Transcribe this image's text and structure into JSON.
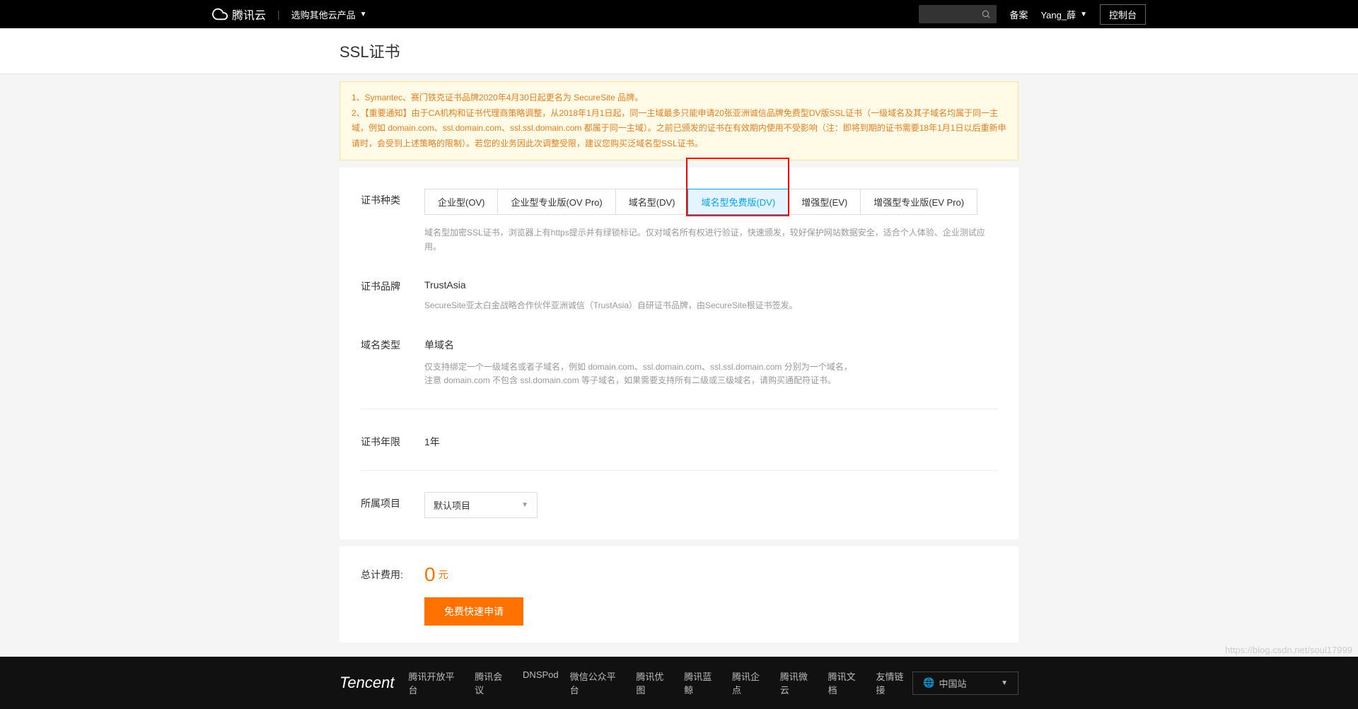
{
  "topbar": {
    "brand": "腾讯云",
    "product_select": "选购其他云产品",
    "links": {
      "beian": "备案",
      "user": "Yang_薛",
      "console": "控制台"
    }
  },
  "page_title": "SSL证书",
  "notice": {
    "line1": "1、Symantec、赛门铁克证书品牌2020年4月30日起更名为 SecureSite 品牌。",
    "line2": "2、【重要通知】由于CA机构和证书代理商策略调整，从2018年1月1日起，同一主域最多只能申请20张亚洲诚信品牌免费型DV版SSL证书（一级域名及其子域名均属于同一主域，例如 domain.com、ssl.domain.com、ssl.ssl.domain.com 都属于同一主域）。之前已颁发的证书在有效期内使用不受影响（注：即将到期的证书需要18年1月1日以后重新申请时，会受到上述策略的限制）。若您的业务因此次调整受限，建议您购买泛域名型SSL证书。"
  },
  "form": {
    "cert_type": {
      "label": "证书种类",
      "tabs": [
        "企业型(OV)",
        "企业型专业版(OV Pro)",
        "域名型(DV)",
        "域名型免费版(DV)",
        "增强型(EV)",
        "增强型专业版(EV Pro)"
      ],
      "desc": "域名型加密SSL证书，浏览器上有https提示并有绿锁标记。仅对域名所有权进行验证，快速颁发，较好保护网站数据安全，适合个人体验、企业测试应用。"
    },
    "brand": {
      "label": "证书品牌",
      "value": "TrustAsia",
      "desc": "SecureSite亚太白金战略合作伙伴亚洲诚信（TrustAsia）自研证书品牌，由SecureSite根证书签发。"
    },
    "domain_type": {
      "label": "域名类型",
      "value": "单域名",
      "desc1": "仅支持绑定一个一级域名或者子域名，例如 domain.com、ssl.domain.com、ssl.ssl.domain.com 分别为一个域名，",
      "desc2": "注意 domain.com 不包含 ssl.domain.com 等子域名，如果需要支持所有二级或三级域名，请购买通配符证书。"
    },
    "duration": {
      "label": "证书年限",
      "value": "1年"
    },
    "project": {
      "label": "所属项目",
      "value": "默认项目"
    }
  },
  "total": {
    "label": "总计费用:",
    "price": "0",
    "unit": "元"
  },
  "submit": "免费快速申请",
  "footer": {
    "logo": "Tencent",
    "links": [
      "腾讯开放平台",
      "腾讯会议",
      "DNSPod",
      "微信公众平台",
      "腾讯优图",
      "腾讯蓝鲸",
      "腾讯企点",
      "腾讯微云",
      "腾讯文档",
      "友情链接"
    ],
    "region": "中国站"
  },
  "watermark": "https://blog.csdn.net/soul17999"
}
